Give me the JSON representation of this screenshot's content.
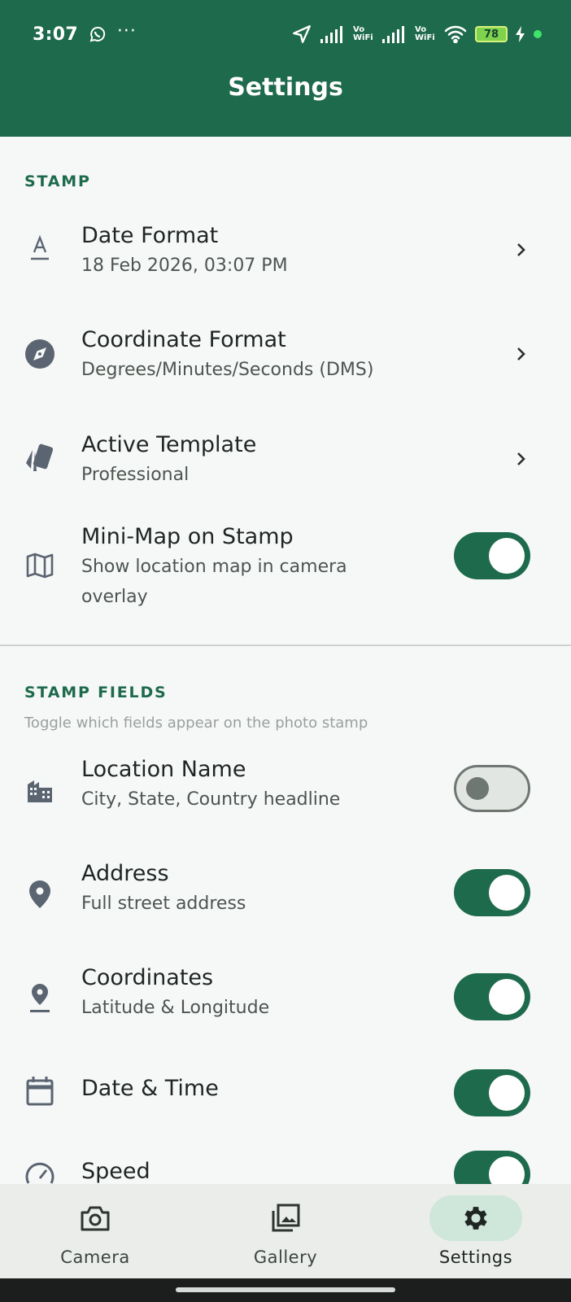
{
  "status_bar": {
    "time": "3:07",
    "overflow": "···",
    "vowifi_1": "Vo WiFi",
    "vowifi_2": "Vo WiFi",
    "battery": "78",
    "icons": [
      "whatsapp-icon",
      "location-arrow-icon",
      "signal-icon",
      "wifi-icon",
      "battery-icon",
      "charging-icon"
    ]
  },
  "header": {
    "title": "Settings"
  },
  "stamp_section": {
    "header": "STAMP",
    "items": [
      {
        "title": "Date Format",
        "subtitle": "18 Feb 2026, 03:07 PM",
        "icon": "font-icon"
      },
      {
        "title": "Coordinate Format",
        "subtitle": "Degrees/Minutes/Seconds (DMS)",
        "icon": "compass-icon"
      },
      {
        "title": "Active Template",
        "subtitle": "Professional",
        "icon": "template-cards-icon"
      },
      {
        "title": "Mini-Map on Stamp",
        "subtitle_line1": "Show location map in camera",
        "subtitle_line2": "overlay",
        "icon": "map-icon",
        "enabled": true
      }
    ]
  },
  "fields_section": {
    "header": "STAMP FIELDS",
    "description": "Toggle which fields appear on the photo stamp",
    "items": [
      {
        "title": "Location Name",
        "subtitle": "City, State, Country headline",
        "icon": "city-icon",
        "enabled": false
      },
      {
        "title": "Address",
        "subtitle": "Full street address",
        "icon": "location-pin-icon",
        "enabled": true
      },
      {
        "title": "Coordinates",
        "subtitle": "Latitude & Longitude",
        "icon": "pin-drop-icon",
        "enabled": true
      },
      {
        "title": "Date & Time",
        "icon": "calendar-icon",
        "enabled": true
      },
      {
        "title": "Speed",
        "icon": "speedometer-icon",
        "enabled": true
      }
    ]
  },
  "bottom_nav": {
    "items": [
      {
        "label": "Camera",
        "icon": "camera-icon"
      },
      {
        "label": "Gallery",
        "icon": "gallery-icon"
      },
      {
        "label": "Settings",
        "icon": "gear-icon",
        "active": true
      }
    ]
  },
  "colors": {
    "primary": "#1e6a4c",
    "background": "#f6f8f7",
    "icon_gray": "#5b6471",
    "nav_active_pill": "#cfe6da"
  }
}
